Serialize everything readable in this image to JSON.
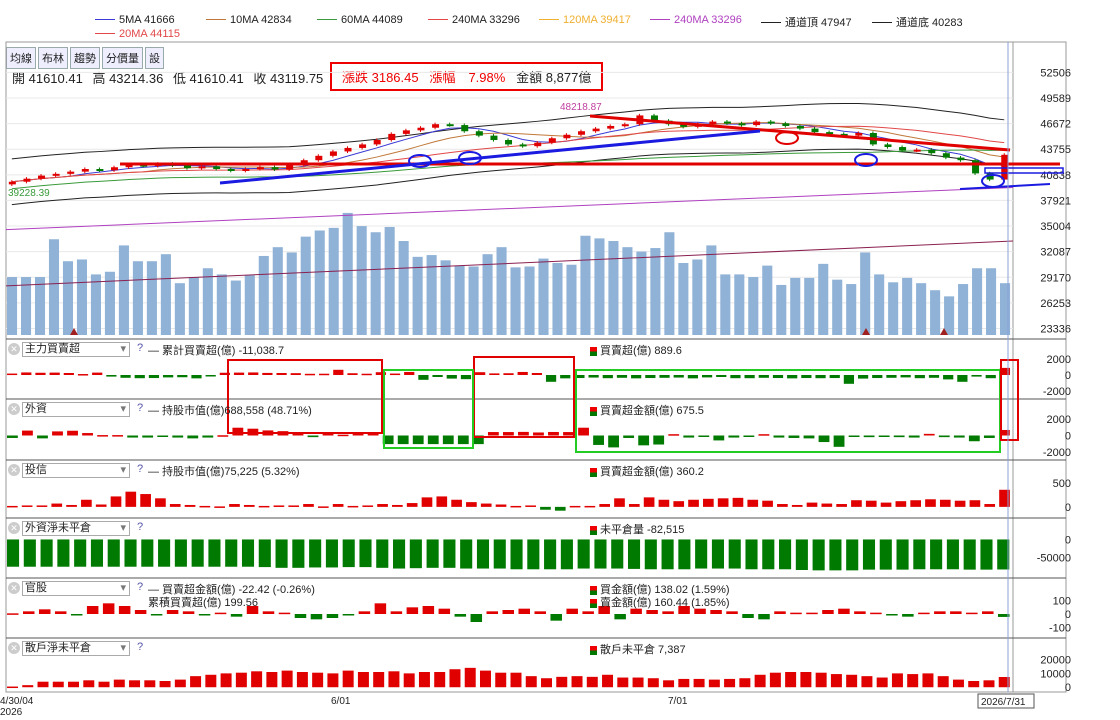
{
  "legend": [
    {
      "label": "5MA 41666",
      "color": "#3b3bd6"
    },
    {
      "label": "10MA 42834",
      "color": "#c0783a"
    },
    {
      "label": "60MA 44089",
      "color": "#3a9a3a"
    },
    {
      "label": "240MA 33296",
      "color": "#e24848"
    },
    {
      "label": "120MA 39417",
      "color": "#f0b030"
    },
    {
      "label": "240MA 33296",
      "color": "#b040c0"
    },
    {
      "label": "通道頂 47947",
      "color": "#222222"
    },
    {
      "label": "通道底 40283",
      "color": "#222222"
    },
    {
      "label": "20MA 44115",
      "color": "#e24848"
    }
  ],
  "tabs": [
    "均線",
    "布林",
    "趨勢",
    "分價量",
    "設"
  ],
  "ohlc": {
    "open": "開 41610.41",
    "high": "高 43214.36",
    "low": "低 41610.41",
    "close": "收 43119.75"
  },
  "stats": {
    "change": "漲跌 3186.45",
    "pct": "漲幅　7.98%",
    "amount": "金額 8,877億"
  },
  "price_annotations": {
    "high": "48218.87",
    "low": "39228.39"
  },
  "colors": {
    "up": "#e00000",
    "down": "#007a00",
    "volume": "#8fb2d6",
    "highlight_red": "#e00000",
    "highlight_green": "#22cc22",
    "trend_blue": "#1a1ae0"
  },
  "panels": [
    {
      "select": "主力買賣超",
      "q": "?",
      "left_text": "累計買賣超(億) -11,038.7",
      "right_text": "買賣超(億) 889.6",
      "yticks": [
        "2000",
        "0",
        "-2000"
      ]
    },
    {
      "select": "外資",
      "q": "?",
      "left_text": "持股市值(億)688,558 (48.71%)",
      "right_text": "買賣超金額(億) 675.5",
      "yticks": [
        "2000",
        "0",
        "-2000"
      ]
    },
    {
      "select": "投信",
      "q": "?",
      "left_text": "持股市值(億)75,225 (5.32%)",
      "right_text": "買賣超金額(億) 360.2",
      "yticks": [
        "500",
        "0"
      ]
    },
    {
      "select": "外資淨未平倉",
      "q": "?",
      "left_text": "",
      "right_text": "未平倉量 -82,515",
      "yticks": [
        "0",
        "-50000"
      ]
    },
    {
      "select": "官股",
      "q": "?",
      "left_text": "買賣超金額(億) -22.42 (-0.26%)",
      "left_text2": "累積買賣超(億) 199.56",
      "right_text": "買金額(億) 138.02 (1.59%)",
      "right_text2": "賣金額(億) 160.44 (1.85%)",
      "yticks": [
        "100",
        "0",
        "-100"
      ]
    },
    {
      "select": "散戶淨未平倉",
      "q": "?",
      "left_text": "",
      "right_text": "散戶未平倉 7,387",
      "yticks": [
        "20000",
        "10000",
        "0"
      ]
    }
  ],
  "xaxis": {
    "start": "4/30/04",
    "year": "2026",
    "m1": "6/01",
    "m2": "7/01",
    "cursor": "2026/7/31"
  },
  "chart_data": {
    "type": "candlestick",
    "price_yticks": [
      52506,
      49589,
      46672,
      43755,
      40838,
      37921,
      35004,
      32087,
      29170,
      26253,
      23336
    ],
    "close": [
      40050,
      40400,
      40750,
      40950,
      41200,
      41500,
      41350,
      41700,
      42000,
      41850,
      42100,
      41900,
      41600,
      41800,
      41500,
      41300,
      41500,
      41700,
      41450,
      41950,
      42500,
      43000,
      43500,
      43900,
      44300,
      44800,
      45500,
      45900,
      46200,
      46600,
      46500,
      45800,
      45300,
      44800,
      44300,
      44100,
      44500,
      45000,
      45400,
      45800,
      46100,
      46400,
      46600,
      47600,
      47000,
      46600,
      46300,
      46600,
      46900,
      46700,
      46500,
      46900,
      46700,
      46400,
      46100,
      45700,
      45500,
      45300,
      45600,
      44300,
      44000,
      43600,
      43700,
      43300,
      42800,
      42500,
      41000,
      40300,
      43119
    ],
    "volume": [
      29200,
      29200,
      29200,
      33500,
      31000,
      31200,
      29500,
      29800,
      32800,
      31000,
      31000,
      31800,
      28500,
      29200,
      30200,
      29500,
      28800,
      29400,
      31600,
      32600,
      32000,
      33800,
      34500,
      34800,
      36500,
      35000,
      34300,
      34900,
      33300,
      31500,
      31700,
      31100,
      30500,
      30400,
      31800,
      32600,
      30300,
      30400,
      31300,
      30800,
      30600,
      33900,
      33600,
      33300,
      32600,
      32100,
      32500,
      34300,
      30800,
      31200,
      32800,
      29500,
      29500,
      29200,
      30500,
      28300,
      29100,
      29100,
      30700,
      28900,
      28400,
      32000,
      29500,
      28600,
      29100,
      28500,
      27700,
      27000,
      28400,
      30200,
      30200,
      28500
    ],
    "main_force": [
      180,
      320,
      280,
      300,
      250,
      120,
      300,
      -200,
      -350,
      -400,
      -380,
      -300,
      -280,
      -420,
      -120,
      280,
      300,
      320,
      260,
      250,
      230,
      150,
      160,
      650,
      220,
      160,
      350,
      180,
      380,
      -600,
      -250,
      -450,
      -520,
      350,
      200,
      220,
      380,
      250,
      -850,
      -420,
      -380,
      -320,
      -400,
      -350,
      -420,
      -380,
      -350,
      -320,
      -420,
      -300,
      -250,
      -400,
      -400,
      -350,
      -380,
      -420,
      -380,
      -400,
      -380,
      -1100,
      -450,
      -380,
      -350,
      -300,
      -400,
      -350,
      -550,
      -850,
      -200,
      -400,
      889
    ],
    "foreign": [
      -300,
      600,
      -350,
      500,
      580,
      300,
      50,
      50,
      -250,
      -250,
      -150,
      -250,
      -350,
      -250,
      30,
      950,
      830,
      620,
      530,
      400,
      -200,
      200,
      100,
      380,
      270,
      -1050,
      -1050,
      -1050,
      -1050,
      -1050,
      -1050,
      -1050,
      420,
      420,
      440,
      370,
      430,
      420,
      950,
      -1150,
      -1450,
      -300,
      -1200,
      -1100,
      160,
      -250,
      -150,
      -600,
      -250,
      -150,
      160,
      -250,
      -300,
      -350,
      -800,
      -1380,
      -100,
      -200,
      -150,
      -200,
      -250,
      200,
      -200,
      -250,
      -700,
      -300,
      675
    ],
    "sitc": [
      20,
      30,
      30,
      70,
      40,
      150,
      50,
      220,
      320,
      270,
      180,
      60,
      40,
      20,
      10,
      60,
      40,
      20,
      30,
      30,
      60,
      10,
      60,
      20,
      30,
      60,
      40,
      80,
      200,
      220,
      150,
      100,
      70,
      50,
      20,
      30,
      -60,
      -80,
      20,
      20,
      60,
      180,
      60,
      200,
      150,
      120,
      150,
      170,
      180,
      190,
      150,
      130,
      60,
      40,
      90,
      70,
      60,
      140,
      130,
      90,
      120,
      140,
      160,
      150,
      130,
      140,
      60,
      360
    ],
    "foreign_oi": [
      -75000,
      -75000,
      -75000,
      -75000,
      -75000,
      -75000,
      -75000,
      -75000,
      -75000,
      -75000,
      -75000,
      -75000,
      -75000,
      -75000,
      -75000,
      -76000,
      -78000,
      -78000,
      -77000,
      -77000,
      -76000,
      -76000,
      -78000,
      -80000,
      -79000,
      -78000,
      -78000,
      -80000,
      -80000,
      -80000,
      -82000,
      -82000,
      -82000,
      -82000,
      -80000,
      -80000,
      -80000,
      -81000,
      -82000,
      -82000,
      -82000,
      -80000,
      -80000,
      -80000,
      -82000,
      -82000,
      -82000,
      -84000,
      -85000,
      -85000,
      -85000,
      -83000,
      -83000,
      -83000,
      -82000,
      -82000,
      -82000,
      -83000,
      -83000,
      -82515
    ],
    "govt": [
      5,
      20,
      35,
      20,
      -10,
      60,
      80,
      60,
      30,
      -10,
      30,
      20,
      -10,
      10,
      -20,
      60,
      20,
      10,
      -30,
      -40,
      -30,
      -10,
      20,
      80,
      20,
      50,
      60,
      40,
      -20,
      -60,
      20,
      30,
      40,
      20,
      -50,
      40,
      20,
      60,
      -40,
      40,
      30,
      20,
      60,
      40,
      30,
      20,
      -30,
      -40,
      20,
      10,
      10,
      30,
      40,
      20,
      10,
      -10,
      -20,
      10,
      20,
      20,
      10,
      20,
      -22
    ],
    "retail_oi": [
      500,
      1500,
      4000,
      4000,
      4000,
      5000,
      4000,
      5500,
      5000,
      5000,
      4500,
      5500,
      8000,
      9000,
      10000,
      10500,
      11500,
      11000,
      12000,
      11000,
      10500,
      10000,
      12000,
      11000,
      11000,
      11500,
      10000,
      11000,
      11000,
      13000,
      14000,
      12000,
      10500,
      10500,
      8000,
      6500,
      7500,
      8000,
      7500,
      9000,
      7000,
      7000,
      6500,
      5000,
      6000,
      6000,
      5500,
      6000,
      6500,
      9000,
      10500,
      11000,
      11000,
      10500,
      9500,
      9000,
      8000,
      7000,
      10000,
      9500,
      10000,
      8000,
      5500,
      4500,
      5000,
      7387
    ]
  }
}
